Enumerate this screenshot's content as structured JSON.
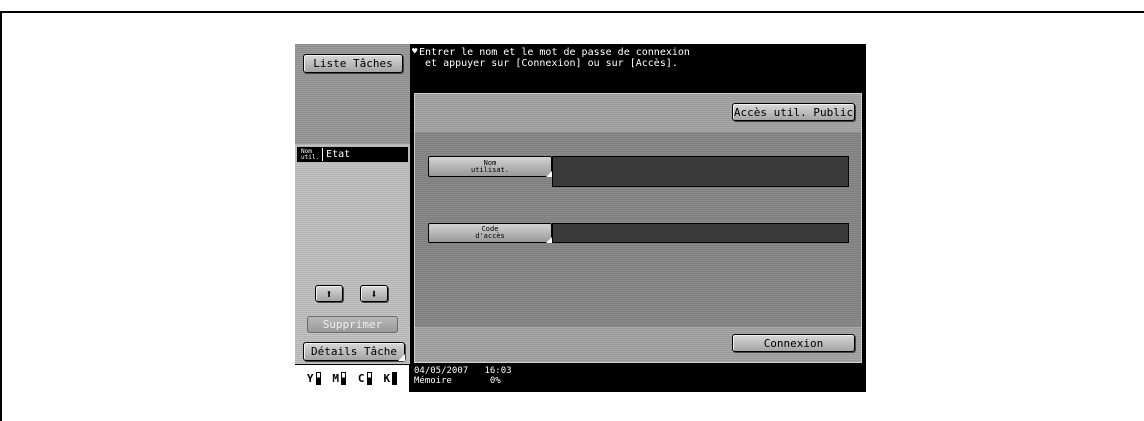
{
  "left_panel": {
    "job_list_button": "Liste Tâches",
    "column_user_top": "Nom",
    "column_user_bottom": "util.",
    "column_status": "Etat",
    "delete_button": "Supprimer",
    "job_details_button": "Détails Tâche",
    "toner": [
      {
        "label": "Y",
        "level": 0.6
      },
      {
        "label": "M",
        "level": 0.6
      },
      {
        "label": "C",
        "level": 0.6
      },
      {
        "label": "K",
        "level": 1.0
      }
    ]
  },
  "message": {
    "line1": "Entrer le nom et le mot de passe de connexion",
    "line2": " et appuyer sur [Connexion] ou sur [Accès]."
  },
  "content": {
    "public_user_button": "Accès util. Public",
    "username_label_top": "Nom",
    "username_label_bottom": "utilisat.",
    "password_label_top": "Code",
    "password_label_bottom": "d'accès",
    "login_button": "Connexion"
  },
  "status_bar": {
    "date": "04/05/2007",
    "time": "16:03",
    "memory_label": "Mémoire",
    "memory_value": "0%"
  }
}
